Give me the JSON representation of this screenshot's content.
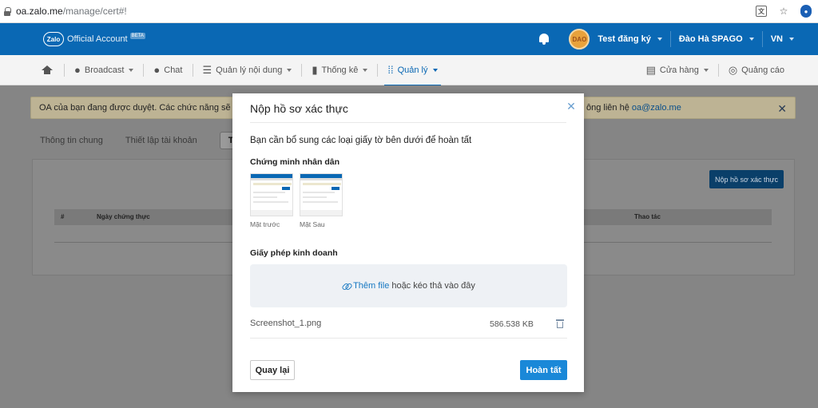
{
  "browser": {
    "url_host": "oa.zalo.me",
    "url_path": "/manage/cert#!"
  },
  "header": {
    "logo_mark": "Zalo",
    "logo_text": "Official Account",
    "logo_badge": "BETA",
    "avatar_text": "DAO",
    "account_name": "Test đăng ký",
    "user_name": "Đào Hà SPAGO",
    "language": "VN"
  },
  "nav": {
    "items": [
      {
        "label": "Broadcast",
        "icon": "chat-bubble-icon"
      },
      {
        "label": "Chat",
        "icon": "chat-icon"
      },
      {
        "label": "Quản lý nội dung",
        "icon": "list-icon"
      },
      {
        "label": "Thống kê",
        "icon": "bar-chart-icon"
      },
      {
        "label": "Quản lý",
        "icon": "grid-icon"
      }
    ],
    "right_items": [
      {
        "label": "Cửa hàng",
        "icon": "store-icon"
      },
      {
        "label": "Quảng cáo",
        "icon": "target-icon"
      }
    ]
  },
  "banner": {
    "text": "OA của bạn đang được duyệt. Các chức năng sẽ bị kh",
    "contact_text": "ông liên hệ",
    "email": "oa@zalo.me"
  },
  "page_tabs": [
    "Thông tin chung",
    "Thiết lập tài khoản",
    "Tài li"
  ],
  "page_button": "Nộp hồ sơ xác thực",
  "table": {
    "col_index": "#",
    "col_date": "Ngày chứng thực",
    "col_action": "Thao tác"
  },
  "modal": {
    "title": "Nộp hồ sơ xác thực",
    "intro": "Bạn cần bổ sung các loại giấy tờ bên dưới để hoàn tất",
    "id_section": "Chứng minh nhân dân",
    "front_caption": "Mặt trước",
    "back_caption": "Mặt Sau",
    "license_section": "Giấy phép kinh doanh",
    "dropzone_link": "Thêm file",
    "dropzone_text": "hoặc kéo thả vào đây",
    "file": {
      "name": "Screenshot_1.png",
      "size": "586.538 KB"
    },
    "back_button": "Quay lại",
    "done_button": "Hoàn tất"
  },
  "colors": {
    "header_blue": "#0a68b4",
    "primary_button": "#1a88d8",
    "banner_bg": "#bdb394"
  }
}
